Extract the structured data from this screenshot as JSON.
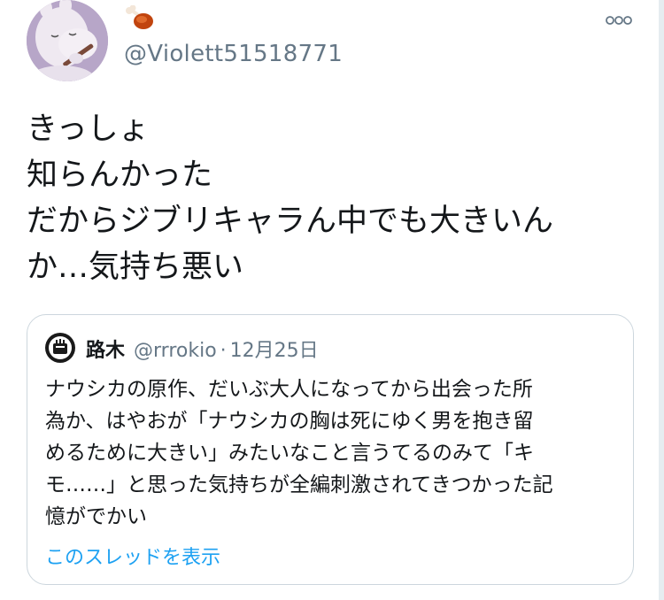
{
  "tweet": {
    "handle": "@Violett51518771",
    "name_emoji": "meat-on-bone-emoji",
    "more_icon": "ellipsis-circle-icon",
    "text_lines": [
      "きっしょ",
      "知らんかった",
      "だからジブリキャラん中でも大きいん",
      "か…気持ち悪い"
    ]
  },
  "quote": {
    "name": "路木",
    "handle": "@rrrokio",
    "separator": "·",
    "date": "12月25日",
    "text_lines": [
      "ナウシカの原作、だいぶ大人になってから出会った所",
      "為か、はやおが「ナウシカの胸は死にゆく男を抱き留",
      "めるために大きい」みたいなこと言うてるのみて「キ",
      "モ……」と思った気持ちが全編刺激されてきつかった記",
      "憶がでかい"
    ],
    "thread_link": "このスレッドを表示"
  },
  "colors": {
    "text": "#14171a",
    "secondary": "#657786",
    "link": "#1da1f2",
    "border": "#ccd6dd"
  }
}
